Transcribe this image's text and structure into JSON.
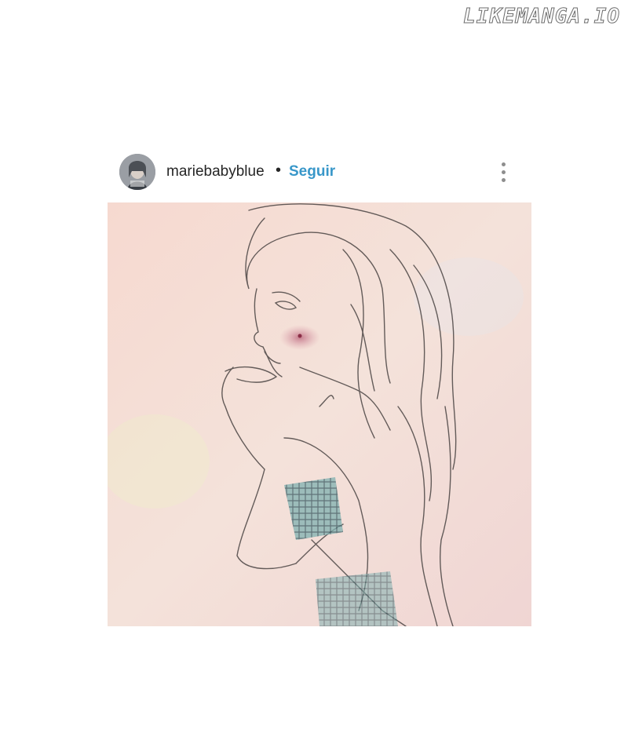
{
  "watermark": "LIKEMANGA.IO",
  "post": {
    "username": "mariebabyblue",
    "separator": "•",
    "follow_label": "Seguir",
    "more_icon": "more-vertical-icon",
    "image_description_icon": "sketch-drawing"
  },
  "colors": {
    "follow": "#3897c9",
    "text": "#262626",
    "muted_icon": "#8e8e8e"
  }
}
